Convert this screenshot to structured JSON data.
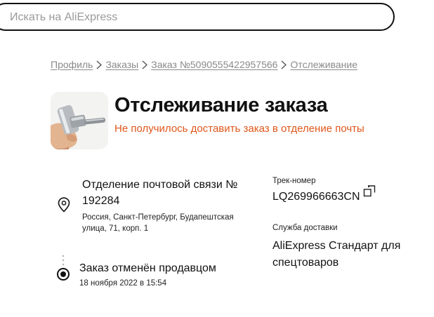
{
  "search": {
    "placeholder": "Искать на AliExpress",
    "value": ""
  },
  "breadcrumb": {
    "items": [
      "Профиль",
      "Заказы",
      "Заказ №5090555422957566",
      "Отслеживание"
    ]
  },
  "header": {
    "title": "Отслеживание заказа",
    "status_message": "Не получилось доставить заказ в отделение почты",
    "status_color": "#e0561a",
    "product_image": "metal-tool-in-hand"
  },
  "address": {
    "icon": "location-pin-icon",
    "title": "Отделение почтовой связи № 192284",
    "detail": "Россия, Санкт-Петербург, Будапештская улица, 71, корп. 1"
  },
  "timeline": {
    "events": [
      {
        "title": "Заказ отменён продавцом",
        "date": "18 ноября 2022 в 15:54"
      }
    ]
  },
  "tracking": {
    "label": "Трек-номер",
    "number": "LQ269966663CN",
    "copy_icon": "copy-icon"
  },
  "delivery": {
    "label": "Служба доставки",
    "service": "AliExpress Стандарт для спецтоваров"
  }
}
